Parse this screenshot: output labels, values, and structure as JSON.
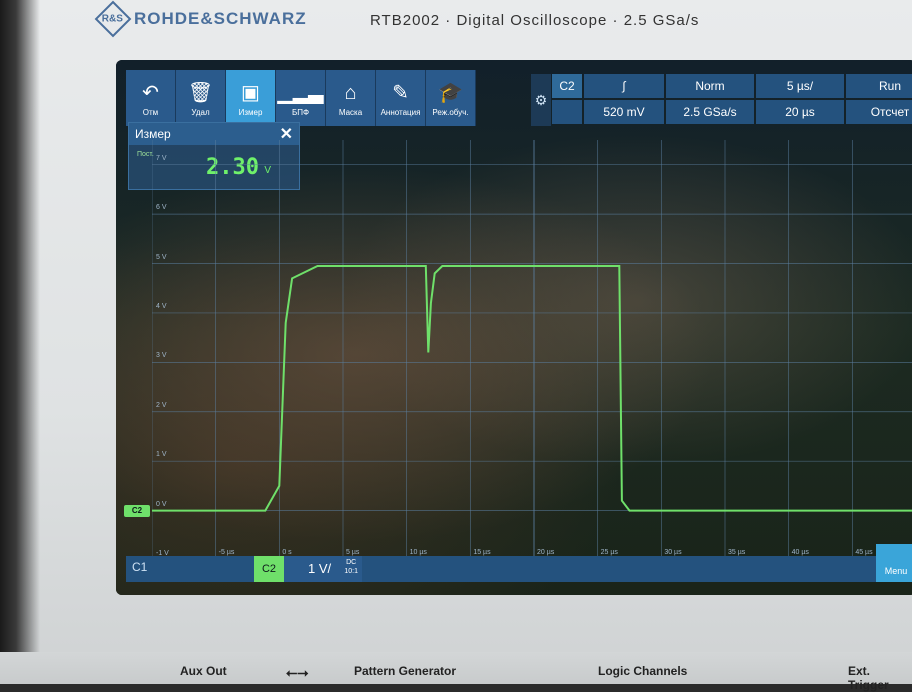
{
  "brand": {
    "logo_letters": "R&S",
    "name": "ROHDE&SCHWARZ",
    "model": "RTB2002",
    "description": "Digital Oscilloscope",
    "rate": "2.5 GSa/s"
  },
  "toolbar": [
    {
      "icon": "undo-icon",
      "glyph": "↶",
      "label": "Отм"
    },
    {
      "icon": "trash-icon",
      "glyph": "🗑",
      "label": "Удал"
    },
    {
      "icon": "measure-icon",
      "glyph": "▣",
      "label": "Измер",
      "active": true
    },
    {
      "icon": "fft-icon",
      "glyph": "▁▂▃",
      "label": "БПФ"
    },
    {
      "icon": "mask-icon",
      "glyph": "⌂",
      "label": "Маска"
    },
    {
      "icon": "pencil-icon",
      "glyph": "✎",
      "label": "Аннотация"
    },
    {
      "icon": "education-icon",
      "glyph": "🎓",
      "label": "Реж.обуч."
    }
  ],
  "settings": {
    "channel": "C2",
    "slope": "∫",
    "level": "520 mV",
    "mode": "Norm",
    "sample_rate": "2.5 GSa/s",
    "time_div": "5 µs/",
    "time_pos": "20 µs",
    "run": "Run",
    "count": "Отсчет"
  },
  "measurement": {
    "title": "Измер",
    "source": "Пост.",
    "value": "2.30",
    "unit": "V"
  },
  "y_labels": [
    "7 V",
    "6 V",
    "5 V",
    "4 V",
    "3 V",
    "2 V",
    "1 V",
    "0 V",
    "-1 V"
  ],
  "x_labels": [
    "-5 µs",
    "0 s",
    "5 µs",
    "10 µs",
    "15 µs",
    "20 µs",
    "25 µs",
    "30 µs",
    "35 µs",
    "40 µs",
    "45 µs"
  ],
  "bottom_bar": {
    "c1": "C1",
    "c2": "C2",
    "scale": "1 V/",
    "coupling": "DC",
    "ratio": "10:1",
    "menu": "Menu"
  },
  "front_panel": [
    "Aux Out",
    "Pattern Generator",
    "Logic Channels",
    "Ext. Trigger"
  ],
  "chart_data": {
    "type": "line",
    "x": [
      -10,
      -1.1,
      0,
      0.5,
      1,
      3,
      11.5,
      11.7,
      11.9,
      12.2,
      12.8,
      13,
      15,
      20,
      26.7,
      26.9,
      27.5,
      50
    ],
    "values": [
      0,
      0,
      0.5,
      3.8,
      4.7,
      4.95,
      4.95,
      3.2,
      4.2,
      4.8,
      4.95,
      4.95,
      4.95,
      4.95,
      4.95,
      0.2,
      0,
      0
    ],
    "ylim": [
      -1,
      7.5
    ],
    "xlim": [
      -10,
      50
    ],
    "series_color": "#6fe06a"
  }
}
